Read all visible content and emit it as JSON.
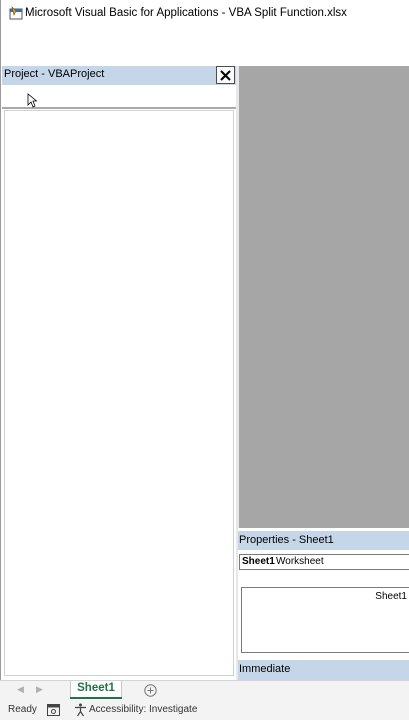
{
  "window": {
    "title": "Microsoft Visual Basic for Applications - VBA Split Function.xlsx"
  },
  "project": {
    "title": "Project - VBAProject",
    "close_glyph": "✕"
  },
  "properties": {
    "title": "Properties - Sheet1",
    "object_name": "Sheet1",
    "object_type": "Worksheet",
    "value": "Sheet1"
  },
  "immediate": {
    "title": "Immediate"
  },
  "sheets": {
    "prev_glyph": "◀",
    "next_glyph": "▶",
    "active_tab": "Sheet1"
  },
  "status": {
    "ready": "Ready",
    "accessibility": "Accessibility: Investigate"
  },
  "colors": {
    "pane_header": "#c5d6e8",
    "code_area": "#a6a6a6",
    "excel_green": "#217346"
  },
  "icons": [
    "vba-app-icon",
    "close-icon",
    "mouse-cursor-icon",
    "add-sheet-icon",
    "macro-record-icon",
    "accessibility-icon"
  ]
}
